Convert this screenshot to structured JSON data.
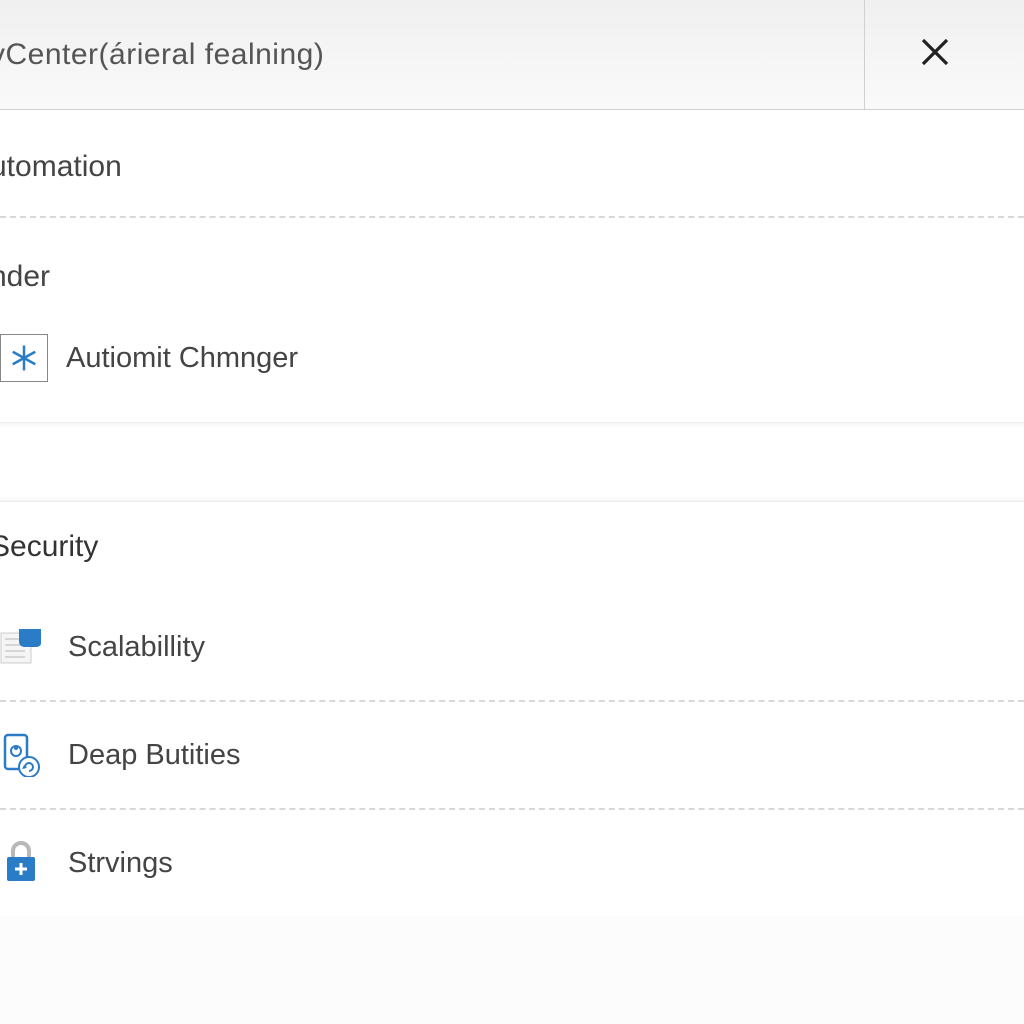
{
  "header": {
    "title": "vCenter(árieral fealning)"
  },
  "section1": {
    "label": "utomation",
    "sublabel": "nder",
    "item": {
      "label": "Autiomit Chmnger"
    }
  },
  "section2": {
    "title": "Security",
    "items": [
      {
        "label": "Scalabillity"
      },
      {
        "label": "Deap Butities"
      },
      {
        "label": "Strvings"
      }
    ]
  }
}
